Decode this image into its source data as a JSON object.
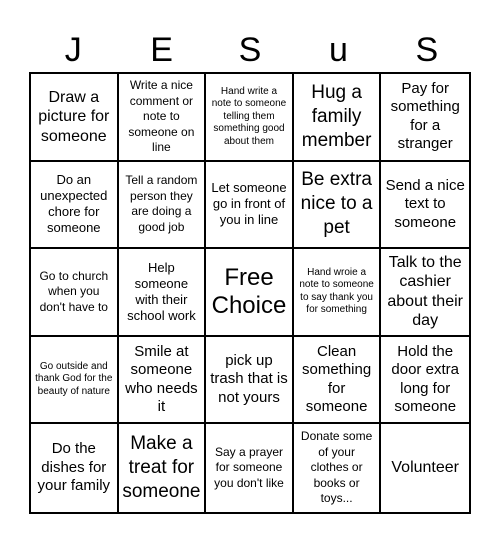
{
  "header": {
    "letters": [
      "J",
      "E",
      "S",
      "u",
      "S"
    ]
  },
  "cells": [
    "Draw a picture for someone",
    "Write a nice comment or note to someone on line",
    "Hand write a note to someone telling them something good about them",
    "Hug a family member",
    "Pay for something for a stranger",
    "Do an unexpected chore for someone",
    "Tell a random person they are doing a good job",
    "Let someone go in front of you in line",
    "Be extra nice to a pet",
    "Send a nice text to someone",
    "Go to church when you don't have to",
    "Help someone with their school work",
    "Free Choice",
    "Hand wroie a note to someone to say thank you for something",
    "Talk to the cashier about their day",
    "Go outside and thank God for the beauty of nature",
    "Smile at someone who needs it",
    "pick up trash that is not yours",
    "Clean something for someone",
    "Hold the door extra long for someone",
    "Do the dishes for your family",
    "Make a treat for someone",
    "Say a prayer for someone you don't like",
    "Donate some of your clothes or books or toys...",
    "Volunteer"
  ]
}
